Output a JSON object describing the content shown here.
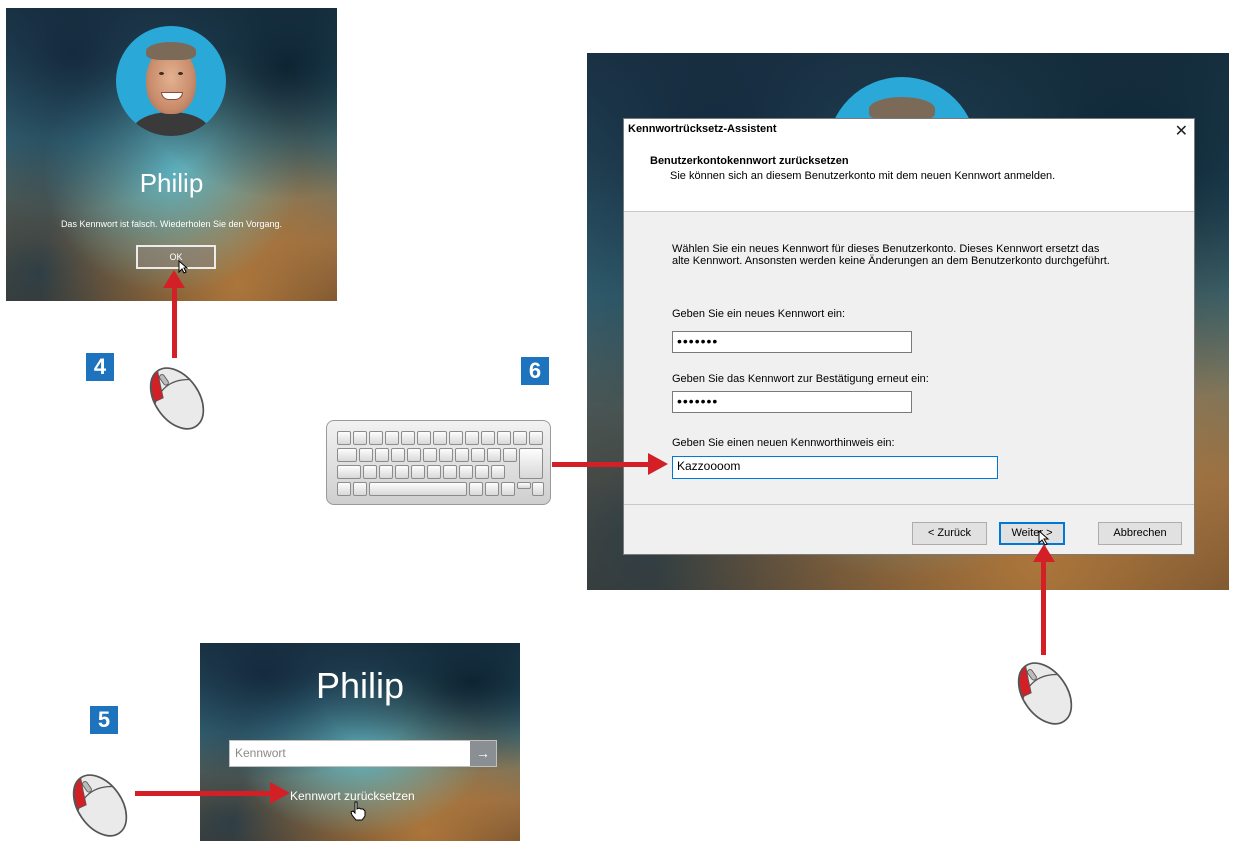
{
  "panel_4": {
    "step_number": "4",
    "user_name": "Philip",
    "error_message": "Das Kennwort ist falsch. Wiederholen Sie den Vorgang.",
    "ok_label": "OK"
  },
  "panel_5": {
    "step_number": "5",
    "user_name": "Philip",
    "password_placeholder": "Kennwort",
    "submit_arrow": "→",
    "reset_link": "Kennwort zurücksetzen"
  },
  "panel_6": {
    "step_number": "6",
    "dialog": {
      "title": "Kennwortrücksetz-Assistent",
      "close_glyph": "✕",
      "header_title": "Benutzerkontokennwort zurücksetzen",
      "header_subtitle": "Sie können sich an diesem Benutzerkonto mit dem neuen Kennwort anmelden.",
      "description": "Wählen Sie ein neues Kennwort für dieses Benutzerkonto. Dieses Kennwort ersetzt das alte Kennwort. Ansonsten werden keine Änderungen an dem Benutzerkonto durchgeführt.",
      "new_password_label": "Geben Sie ein neues Kennwort ein:",
      "new_password_value": "•••••••",
      "confirm_password_label": "Geben Sie das Kennwort zur Bestätigung erneut ein:",
      "confirm_password_value": "•••••••",
      "hint_label": "Geben Sie einen neuen Kennworthinweis ein:",
      "hint_value": "Kazzoooom",
      "back_button": "< Zurück",
      "next_button": "Weiter >",
      "cancel_button": "Abbrechen"
    }
  },
  "colors": {
    "step_badge": "#1e73be",
    "arrow": "#d32027",
    "avatar_ring": "#2aa8d8"
  },
  "icons": [
    "mouse-icon",
    "keyboard-icon",
    "mouse-cursor-icon",
    "hand-cursor-icon",
    "arrow-right-icon",
    "close-icon"
  ]
}
